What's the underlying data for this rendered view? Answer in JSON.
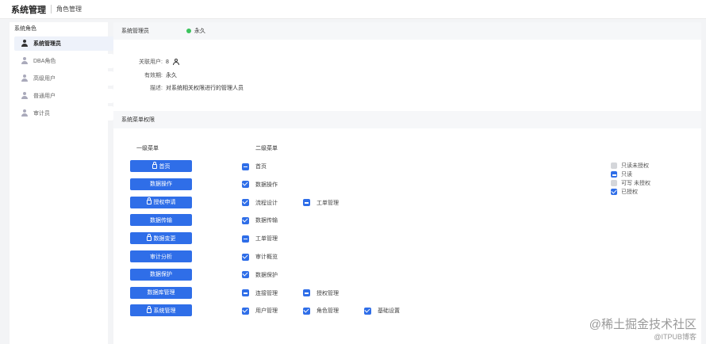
{
  "header": {
    "title": "系统管理",
    "subtitle": "角色管理"
  },
  "sidebar": {
    "title": "系统角色",
    "items": [
      {
        "label": "系统管理员",
        "active": true
      },
      {
        "label": "DBA角色",
        "active": false
      },
      {
        "label": "高级用户",
        "active": false
      },
      {
        "label": "普通用户",
        "active": false
      },
      {
        "label": "审计员",
        "active": false
      }
    ]
  },
  "role": {
    "name": "系统管理员",
    "status": "永久",
    "status_color": "#3cc35d",
    "users_label": "关联用户:",
    "users_value": "8",
    "validity_label": "有效期:",
    "validity_value": "永久",
    "desc_label": "描述:",
    "desc_value": "对系统相关权限进行的管理人员"
  },
  "perm": {
    "section_title": "系统菜单权限",
    "col1": "一级菜单",
    "col2": "二级菜单",
    "rows": [
      {
        "menu": "首页",
        "locked": true,
        "subs": [
          {
            "label": "首页",
            "state": "dash"
          }
        ]
      },
      {
        "menu": "数据操作",
        "locked": false,
        "subs": [
          {
            "label": "数据操作",
            "state": "check"
          }
        ]
      },
      {
        "menu": "授权申请",
        "locked": true,
        "subs": [
          {
            "label": "流程设计",
            "state": "check"
          },
          {
            "label": "工单管理",
            "state": "dash"
          }
        ]
      },
      {
        "menu": "数据传输",
        "locked": false,
        "subs": [
          {
            "label": "数据传输",
            "state": "check"
          }
        ]
      },
      {
        "menu": "数据变更",
        "locked": true,
        "subs": [
          {
            "label": "工单管理",
            "state": "dash"
          }
        ]
      },
      {
        "menu": "审计分析",
        "locked": false,
        "subs": [
          {
            "label": "审计概览",
            "state": "check"
          }
        ]
      },
      {
        "menu": "数据保护",
        "locked": false,
        "subs": [
          {
            "label": "数据保护",
            "state": "check"
          }
        ]
      },
      {
        "menu": "数据库管理",
        "locked": false,
        "subs": [
          {
            "label": "连接管理",
            "state": "dash"
          },
          {
            "label": "授权管理",
            "state": "dash"
          }
        ]
      },
      {
        "menu": "系统管理",
        "locked": true,
        "subs": [
          {
            "label": "用户管理",
            "state": "check"
          },
          {
            "label": "角色管理",
            "state": "check"
          },
          {
            "label": "基础设置",
            "state": "check"
          }
        ]
      }
    ],
    "legend": [
      {
        "label": "只读未授权",
        "state": "gray"
      },
      {
        "label": "只读",
        "state": "dash"
      },
      {
        "label": "可写 未授权",
        "state": "gray"
      },
      {
        "label": "已授权",
        "state": "check"
      }
    ]
  },
  "watermark": {
    "line1": "@稀土掘金技术社区",
    "line2": "@ITPUB博客"
  },
  "colors": {
    "primary": "#2f6ee8",
    "sidebar_active": "#eef2fa",
    "header_bg": "#f6f7f9"
  }
}
